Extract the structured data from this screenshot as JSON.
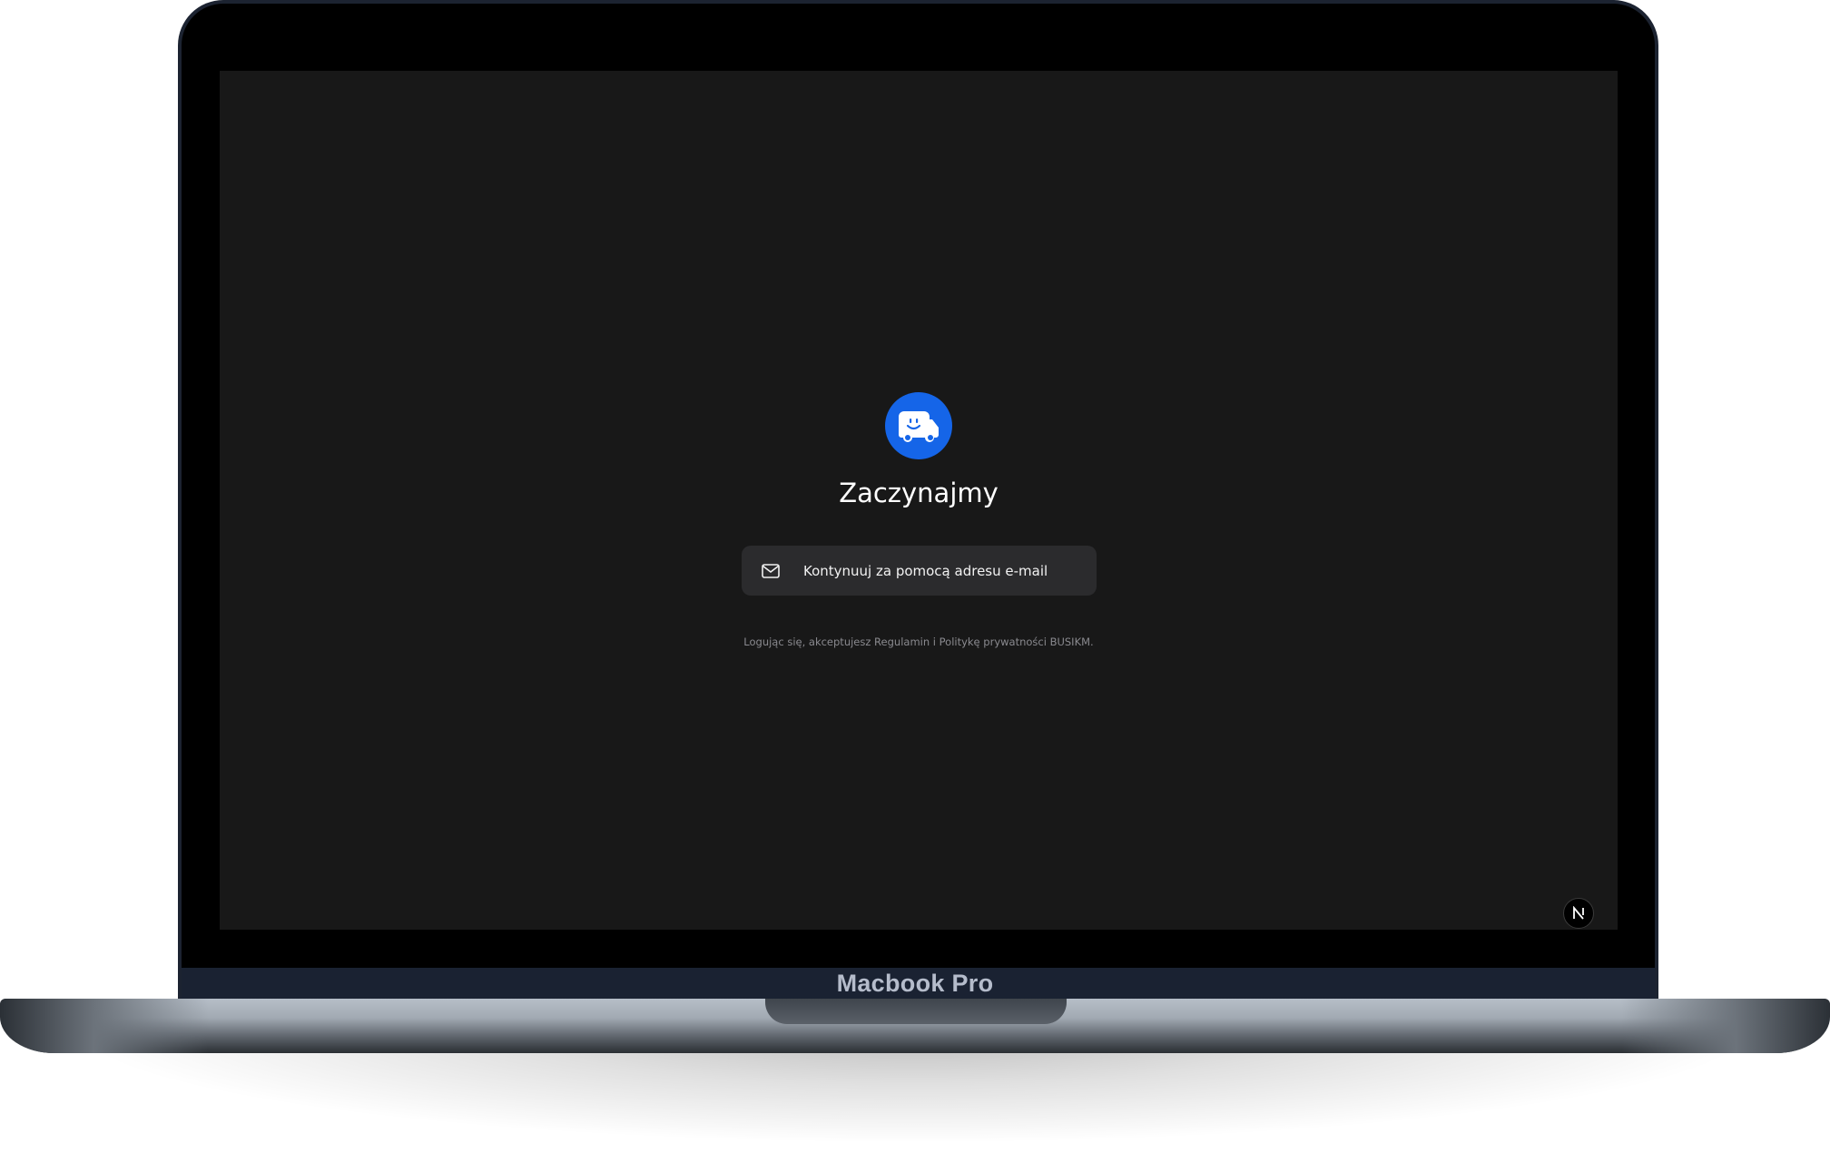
{
  "app": {
    "title": "Zaczynajmy",
    "email_button_label": "Kontynuuj za pomocą adresu e-mail",
    "terms_text": "Logując się, akceptujesz Regulamin i Politykę prywatności BUSIKM.",
    "logo_icon": "smiling-van-icon",
    "accent_color": "#1565e8",
    "email_icon": "envelope-icon",
    "corner_badge_icon": "next-logo-icon",
    "corner_badge_text": "N"
  },
  "device": {
    "label": "Macbook Pro"
  }
}
